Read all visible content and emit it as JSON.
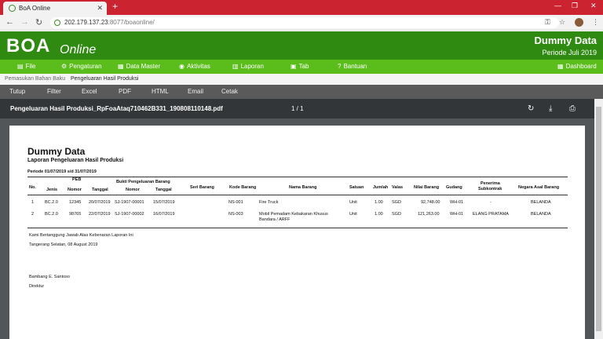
{
  "browser": {
    "tab_title": "BoA Online",
    "url_host": "202.179.137.23",
    "url_rest": ":8077/boaonline/"
  },
  "header": {
    "logo_main": "BOA",
    "logo_sub": "Online",
    "company": "Dummy Data",
    "period": "Periode Juli 2019"
  },
  "menu": {
    "items": [
      {
        "label": "File",
        "icon": "file-icon"
      },
      {
        "label": "Pengaturan",
        "icon": "gear-icon"
      },
      {
        "label": "Data Master",
        "icon": "database-icon"
      },
      {
        "label": "Aktivitas",
        "icon": "activity-icon"
      },
      {
        "label": "Laporan",
        "icon": "report-icon"
      },
      {
        "label": "Tab",
        "icon": "tab-icon"
      },
      {
        "label": "Bantuan",
        "icon": "help-icon"
      }
    ],
    "dashboard": "Dashboard"
  },
  "breadcrumb": {
    "items": [
      "Pemasukan Bahan Baku",
      "Pengeluaran Hasil Produksi"
    ]
  },
  "toolbar": {
    "items": [
      "Tutup",
      "Filter",
      "Excel",
      "PDF",
      "HTML",
      "Email",
      "Cetak"
    ]
  },
  "pdf": {
    "filename": "Pengeluaran Hasil Produksi_RpFoaAtaq710462B331_190808110148.pdf",
    "page": "1 / 1"
  },
  "report": {
    "company": "Dummy Data",
    "title": "Laporan Pengeluaran Hasil Produksi",
    "period": "Periode 01/07/2019 s/d 31/07/2019",
    "headers": {
      "no": "No.",
      "peb": "PEB",
      "jenis": "Jenis",
      "nomor": "Nomor",
      "tanggal": "Tanggal",
      "bukti": "Bukti Pengeluaran Barang",
      "bnomor": "Nomor",
      "btanggal": "Tanggal",
      "seri": "Seri Barang",
      "kode": "Kode Barang",
      "nama": "Nama Barang",
      "satuan": "Satuan",
      "jumlah": "Jumlah",
      "valas": "Valas",
      "nilai": "Nilai Barang",
      "gudang": "Gudang",
      "penerima1": "Penerima",
      "penerima2": "Subkontrak",
      "negara": "Negara Asal Barang"
    },
    "rows": [
      {
        "no": "1",
        "jenis": "BC.2.0",
        "nomor": "12345",
        "tanggal": "20/07/2019",
        "bnomor": "SJ-1907-00001",
        "btanggal": "15/07/2019",
        "kode": "NS-001",
        "nama1": "Fire Truck",
        "nama2": "",
        "satuan": "Unit",
        "jumlah": "1.00",
        "valas": "SGD",
        "nilai": "92,748.00",
        "gudang": "WH-01",
        "penerima": "-",
        "negara": "BELANDA"
      },
      {
        "no": "2",
        "jenis": "BC.2.0",
        "nomor": "98765",
        "tanggal": "22/07/2019",
        "bnomor": "SJ-1907-00002",
        "btanggal": "16/07/2019",
        "kode": "NS-003",
        "nama1": "Mobil Pemadam Kebakaran Khusus",
        "nama2": "Bandara / ARFF",
        "satuan": "Unit",
        "jumlah": "1.00",
        "valas": "SGD",
        "nilai": "121,263.00",
        "gudang": "WH-01",
        "penerima": "ELANG PRATAMA",
        "negara": "BELANDA"
      }
    ],
    "statement": "Kami Bertanggung Jawab Atas Kebenaran Laporan Ini",
    "place_date": "Tangerang Selatan, 08 August 2019",
    "signer": "Bambang E. Santoso",
    "position": "Direktur"
  }
}
